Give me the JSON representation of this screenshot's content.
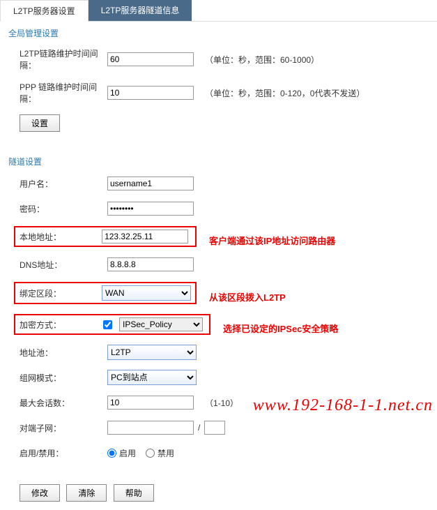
{
  "tabs": {
    "active": "L2TP服务器设置",
    "inactive": "L2TP服务器隧道信息"
  },
  "global": {
    "title": "全局管理设置",
    "l2tp_interval_label": "L2TP链路维护时间间隔：",
    "l2tp_interval_value": "60",
    "l2tp_interval_note": "（单位：秒，范围：60-1000）",
    "ppp_interval_label": "PPP 链路维护时间间隔：",
    "ppp_interval_value": "10",
    "ppp_interval_note": "（单位：秒，范围：0-120，0代表不发送）",
    "set_btn": "设置"
  },
  "tunnel": {
    "title": "隧道设置",
    "username_label": "用户名：",
    "username_value": "username1",
    "password_label": "密码：",
    "password_value": "••••••••",
    "local_addr_label": "本地地址：",
    "local_addr_value": "123.32.25.11",
    "local_addr_note": "客户端通过该IP地址访问路由器",
    "dns_label": "DNS地址：",
    "dns_value": "8.8.8.8",
    "bind_zone_label": "绑定区段：",
    "bind_zone_value": "WAN",
    "bind_zone_note": "从该区段拨入L2TP",
    "encrypt_label": "加密方式：",
    "encrypt_checked": true,
    "encrypt_value": "IPSec_Policy",
    "encrypt_note": "选择已设定的IPSec安全策略",
    "pool_label": "地址池：",
    "pool_value": "L2TP",
    "netmode_label": "组网模式：",
    "netmode_value": "PC到站点",
    "maxsession_label": "最大会话数：",
    "maxsession_value": "10",
    "maxsession_note": "（1-10）",
    "peer_subnet_label": "对端子网：",
    "peer_subnet_value": "",
    "peer_mask_value": "",
    "enable_label": "启用/禁用：",
    "enable_on": "启用",
    "enable_off": "禁用",
    "btn_modify": "修改",
    "btn_clear": "清除",
    "btn_help": "帮助"
  },
  "watermark": "www.192-168-1-1.net.cn"
}
